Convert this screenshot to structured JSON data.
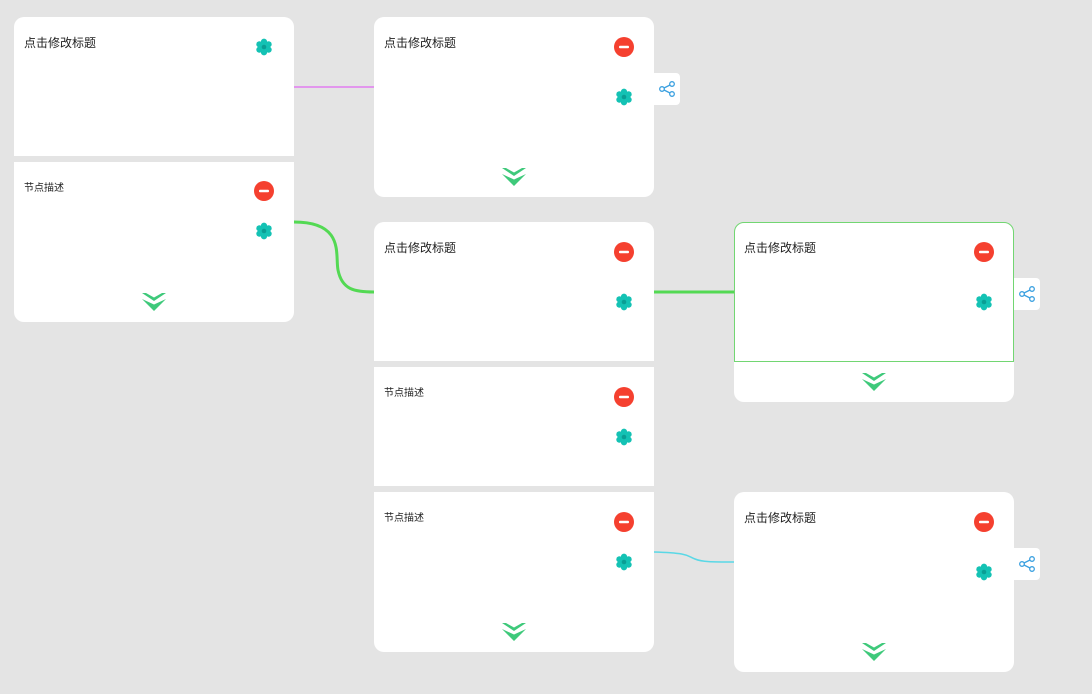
{
  "canvas": {
    "background": "#e4e4e4",
    "node_background": "#ffffff",
    "icon_colors": {
      "remove": "#f5402f",
      "settings": "#14c2b4",
      "expand": "#3ec97a",
      "share": "#3aa0e0"
    },
    "connector_colors": [
      "#e17cf0",
      "#53d953",
      "#53d953",
      "#5ad8e6"
    ],
    "selected_border_color": "#72d672"
  },
  "nodes": [
    {
      "id": "n1",
      "title": "点击修改标题",
      "descriptions": [
        "节点描述"
      ]
    },
    {
      "id": "n2",
      "title": "点击修改标题",
      "descriptions": []
    },
    {
      "id": "n3",
      "title": "点击修改标题",
      "descriptions": [
        "节点描述",
        "节点描述"
      ]
    },
    {
      "id": "n4",
      "title": "点击修改标题",
      "descriptions": [],
      "selected": true
    },
    {
      "id": "n5",
      "title": "点击修改标题",
      "descriptions": []
    }
  ],
  "icons": {
    "remove": "minus-circle-icon",
    "settings": "gear-icon",
    "expand": "double-chevron-down-icon",
    "share": "share-icon"
  }
}
